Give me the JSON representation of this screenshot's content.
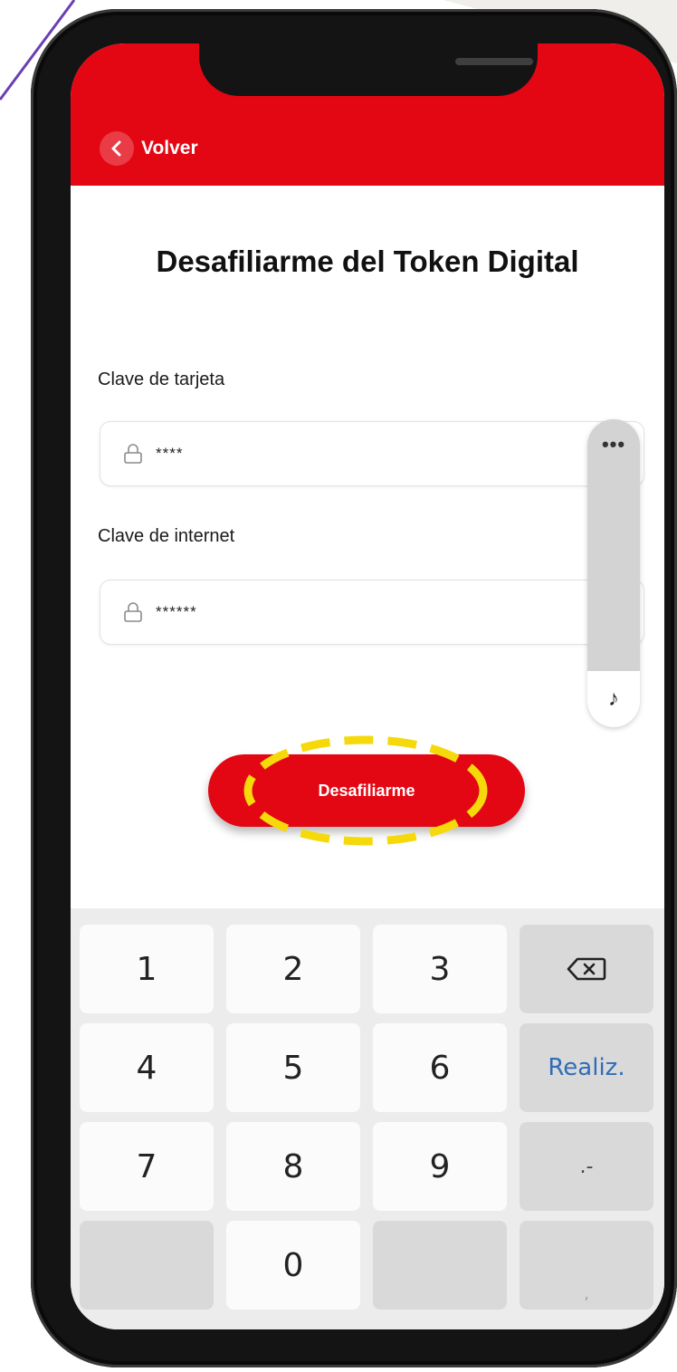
{
  "header": {
    "back_label": "Volver",
    "color": "#e30613"
  },
  "page": {
    "title": "Desafiliarme del Token Digital"
  },
  "form": {
    "card_key": {
      "label": "Clave de tarjeta",
      "value": "****",
      "icon": "lock-icon"
    },
    "internet_key": {
      "label": "Clave de internet",
      "value": "******",
      "icon": "lock-icon"
    }
  },
  "side_panel": {
    "menu_icon": "more-horizontal-icon",
    "menu_glyph": "•••",
    "music_icon": "music-note-icon",
    "music_glyph": "♪"
  },
  "action": {
    "submit_label": "Desafiliarme",
    "highlight_color": "#f5d90a"
  },
  "keyboard": {
    "row1": [
      "1",
      "2",
      "3"
    ],
    "row2": [
      "4",
      "5",
      "6"
    ],
    "row3": [
      "7",
      "8",
      "9"
    ],
    "zero": "0",
    "done_label": "Realiz.",
    "dot_dash": ".-",
    "comma": ",",
    "backspace_icon": "backspace-icon",
    "done_color": "#2f6db8"
  }
}
